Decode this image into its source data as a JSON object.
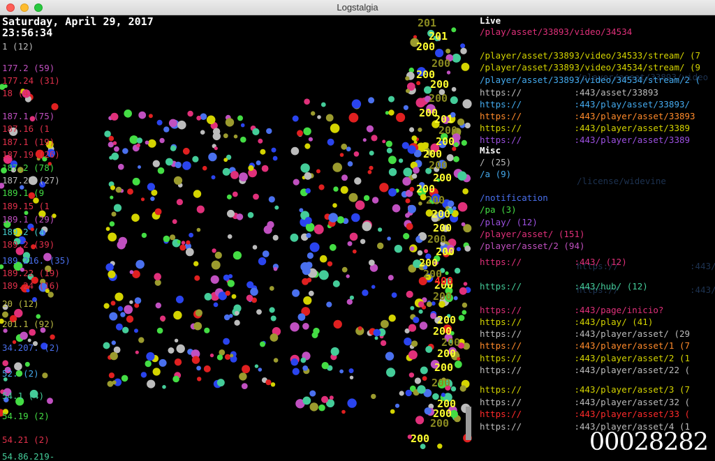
{
  "window": {
    "title": "Logstalgia"
  },
  "clock": {
    "date": "Saturday, April 29, 2017",
    "time": "23:56:34"
  },
  "hosts": [
    {
      "text": "1 (12)",
      "color": "#bcbcbc"
    },
    {
      "text": "177.2 (59)",
      "color": "#c050c0"
    },
    {
      "text": "177.24 (31)",
      "color": "#e0304a"
    },
    {
      "text": "18 (4",
      "color": "#e0304a"
    },
    {
      "text": "187.1 (75)",
      "color": "#c050c0"
    },
    {
      "text": "187.16 (1",
      "color": "#e0304a"
    },
    {
      "text": "187.1 (19)",
      "color": "#e0304a"
    },
    {
      "text": "187.19 (26)",
      "color": "#e0304a"
    },
    {
      "text": "187.2 (78)",
      "color": "#44dd44"
    },
    {
      "text": "187.22 (27)",
      "color": "#bcbcbc"
    },
    {
      "text": "189.1 (9",
      "color": "#44dd44"
    },
    {
      "text": "189.15 (1",
      "color": "#e0304a"
    },
    {
      "text": "189.1 (29)",
      "color": "#c050c0"
    },
    {
      "text": "189.2 (4",
      "color": "#44cccc"
    },
    {
      "text": "189.2 (39)",
      "color": "#e0304a"
    },
    {
      "text": "189.216. (35)",
      "color": "#4a70ee"
    },
    {
      "text": "189.22 (19)",
      "color": "#e0304a"
    },
    {
      "text": "189.24 (16)",
      "color": "#e0304a"
    },
    {
      "text": "20 (12)",
      "color": "#bcbc44"
    },
    {
      "text": "201.1 (92)",
      "color": "#bcbc44"
    },
    {
      "text": "34.207. (2)",
      "color": "#4a70ee"
    },
    {
      "text": "52. (2)",
      "color": "#44aaee"
    },
    {
      "text": "54.1 (4)",
      "color": "#44cc99"
    },
    {
      "text": "54.19 (2)",
      "color": "#44dd44"
    },
    {
      "text": "54.21 (2)",
      "color": "#e0304a"
    },
    {
      "text": "54.86.219-",
      "color": "#44cc99"
    }
  ],
  "response_codes": [
    "201",
    "201",
    "200",
    "200",
    "200",
    "200",
    "200",
    "200",
    "201",
    "200",
    "200",
    "200",
    "200",
    "200",
    "200",
    "200",
    "200",
    "200",
    "200",
    "200",
    "200",
    "200",
    "200",
    "400",
    "200",
    "200",
    "200",
    "200",
    "200",
    "200",
    "200",
    "200",
    "200",
    "200",
    "200"
  ],
  "paths": [
    {
      "text": "Live",
      "color": "#ffffff",
      "header": true
    },
    {
      "text": "/play/asset/33893/video/34534",
      "color": "#e0307a"
    },
    {
      "text": "/player/asset/33893/video/34533/stream/ (7",
      "color": "#d4d400"
    },
    {
      "text": "/player/asset/33893/video/34534/stream/ (9",
      "color": "#d4d400"
    },
    {
      "text": "/player/asset/33893/video/34534/stream/2 (",
      "color": "#44aaee"
    },
    {
      "text": "https://          :443/asset/33893",
      "color": "#bcbcbc"
    },
    {
      "text": "https://          :443/play/asset/33893/",
      "color": "#44aaee"
    },
    {
      "text": "https://          :443/player/asset/33893",
      "color": "#ff8a2a"
    },
    {
      "text": "https://          :443/player/asset/3389",
      "color": "#d4d400"
    },
    {
      "text": "https://          :443/player/asset/3389",
      "color": "#9c50e0"
    },
    {
      "text": "Misc",
      "color": "#ffffff",
      "header": true
    },
    {
      "text": "/ (25)",
      "color": "#bcbcbc"
    },
    {
      "text": "/a (9)",
      "color": "#44aaee"
    },
    {
      "text": "/notification",
      "color": "#4a70ee"
    },
    {
      "text": "/pa (3)",
      "color": "#44dd44"
    },
    {
      "text": "/play/ (12)",
      "color": "#9c50e0"
    },
    {
      "text": "/player/asset/ (151)",
      "color": "#e0307a"
    },
    {
      "text": "/player/asset/2 (94)",
      "color": "#c050c0"
    },
    {
      "text": "https://          :443/ (12)",
      "color": "#e0307a"
    },
    {
      "text": "https://          :443/hub/ (12)",
      "color": "#44cc99"
    },
    {
      "text": "https://          :443/page/inicio?",
      "color": "#e0307a"
    },
    {
      "text": "https://          :443/play/ (41)",
      "color": "#d4d400"
    },
    {
      "text": "https://          :443/player/asset/ (29",
      "color": "#bcbcbc"
    },
    {
      "text": "https://          :443/player/asset/1 (7",
      "color": "#ff8a2a"
    },
    {
      "text": "https://          :443/player/asset/2 (1",
      "color": "#d4d400"
    },
    {
      "text": "https://          :443/player/asset/22 (",
      "color": "#bcbcbc"
    },
    {
      "text": "https://          :443/player/asset/3 (7",
      "color": "#d4d400"
    },
    {
      "text": "https://          :443/player/asset/32 (",
      "color": "#bcbcbc"
    },
    {
      "text": "https://          :443/player/asset/33 (",
      "color": "#ff2a2a"
    },
    {
      "text": "https://          :443/player/asset/4 (1",
      "color": "#bcbcbc"
    }
  ],
  "ghosts": [
    "/player/asset/33893/video",
    "/license/widevine",
    "https://",
    ":443/",
    "https://",
    ":443/"
  ],
  "counter": "00028282",
  "palette": [
    "#44dd44",
    "#e0307a",
    "#c050c0",
    "#4a70ee",
    "#bcbcbc",
    "#d4d400",
    "#44cc99",
    "#9b9b2e",
    "#e02020",
    "#2a44ee"
  ]
}
